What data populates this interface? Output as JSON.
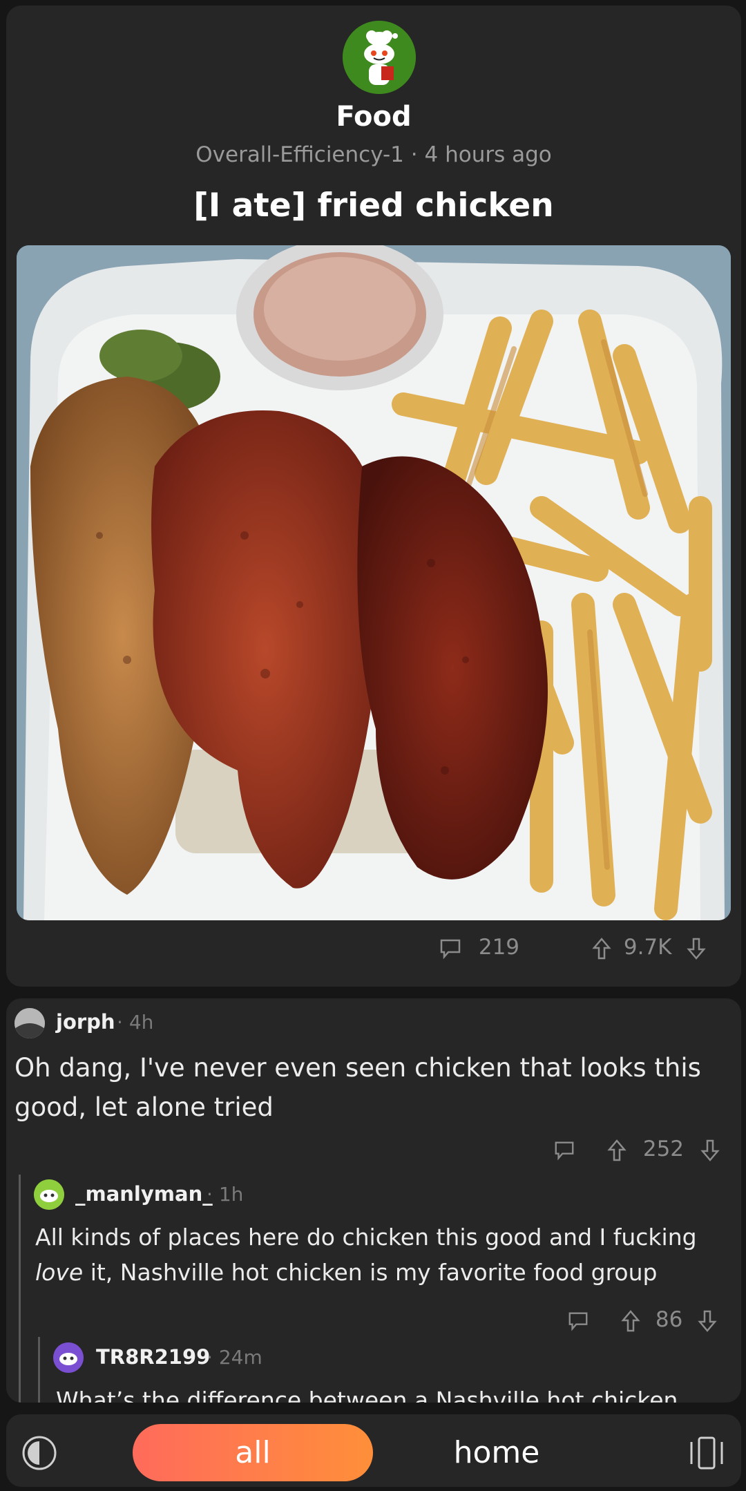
{
  "post": {
    "subreddit": "Food",
    "author": "Overall-Efficiency-1",
    "time": "4 hours ago",
    "meta_separator": "·",
    "title": "[I ate] fried chicken",
    "comment_count": "219",
    "score": "9.7K"
  },
  "comments": [
    {
      "user": "jorph",
      "time": "4h",
      "body_lines": [
        "Oh dang, I've never even seen chicken that looks this",
        "good, let alone tried"
      ],
      "score": "252"
    },
    {
      "user": "_manlyman_",
      "time": "1h",
      "body_line1": "All kinds of places here do chicken this good and I fucking",
      "body_emph": "love",
      "body_line2_rest": " it, Nashville hot chicken is my favorite food group",
      "score": "86"
    },
    {
      "user": "TR8R2199",
      "time": "24m",
      "body_partial": "What’s the difference between a Nashville hot chicken"
    }
  ],
  "bottom_nav": {
    "all_label": "all",
    "home_label": "home",
    "accent_from": "#ff6b5b",
    "accent_to": "#ff8f3a"
  }
}
